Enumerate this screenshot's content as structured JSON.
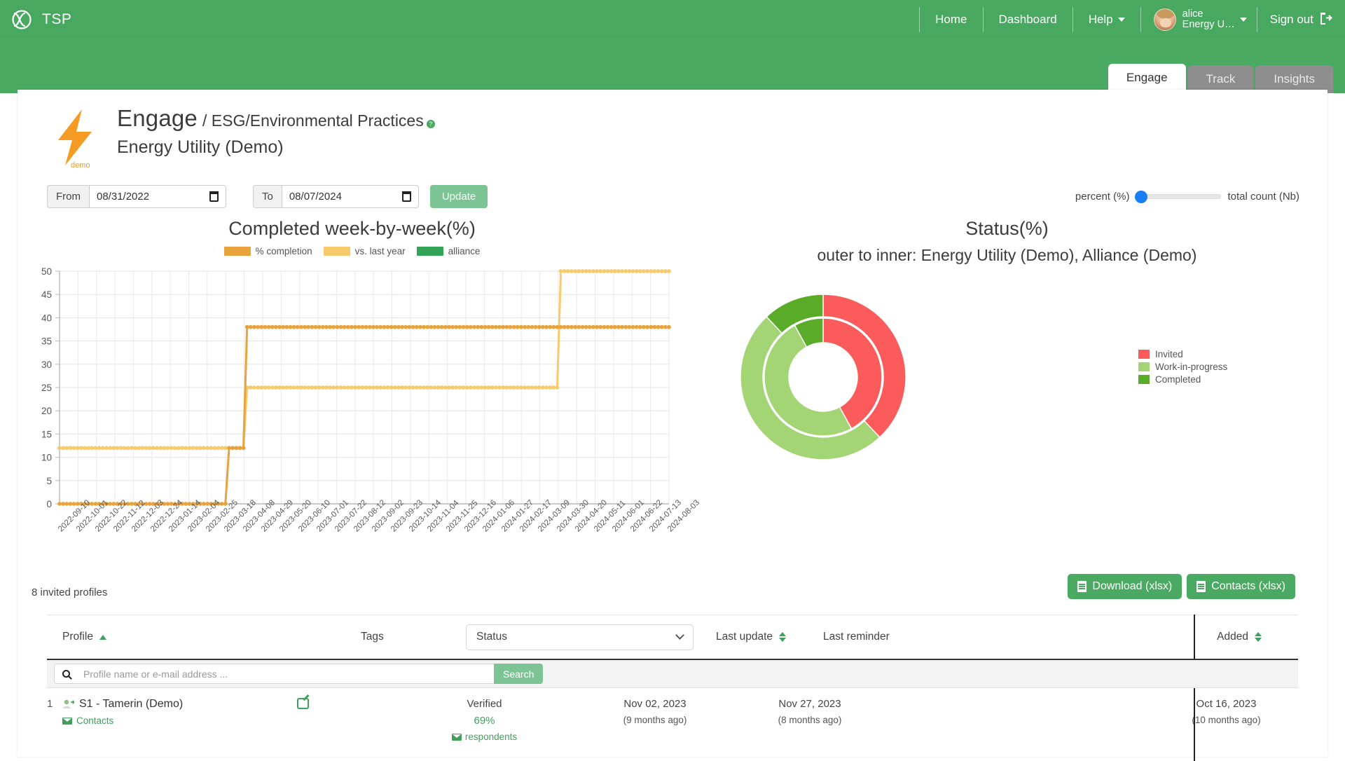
{
  "navbar": {
    "brand": "TSP",
    "links": [
      {
        "label": "Home",
        "icon": "none"
      },
      {
        "label": "Dashboard",
        "icon": "none"
      },
      {
        "label": "Help",
        "icon": "chevron-down-icon"
      }
    ],
    "user": {
      "name": "alice",
      "org": "Energy U…"
    },
    "signout": "Sign out"
  },
  "tabs": [
    {
      "label": "Engage",
      "active": true
    },
    {
      "label": "Track",
      "active": false
    },
    {
      "label": "Insights",
      "active": false
    }
  ],
  "header": {
    "app": "Engage",
    "path": "/ ESG/Environmental Practices",
    "subtitle": "Energy Utility (Demo)",
    "logo_caption": "demo",
    "help_badge": "?"
  },
  "filters": {
    "from_label": "From",
    "from_value": "08/31/2022",
    "to_label": "To",
    "to_value": "08/07/2024",
    "update_label": "Update",
    "slider_left": "percent (%)",
    "slider_right": "total count (Nb)",
    "slider_position": 0
  },
  "line_chart_legend": [
    {
      "label": "% completion",
      "color": "#e8a33d"
    },
    {
      "label": "vs. last year",
      "color": "#f7ca6b"
    },
    {
      "label": "alliance",
      "color": "#33a457"
    }
  ],
  "donut_legend": [
    {
      "label": "Invited",
      "color": "#fb5b5b"
    },
    {
      "label": "Work-in-progress",
      "color": "#a3d575"
    },
    {
      "label": "Completed",
      "color": "#5aab28"
    }
  ],
  "summary": {
    "invited_profiles": "8 invited profiles",
    "download_label": "Download (xlsx)",
    "contacts_label": "Contacts (xlsx)"
  },
  "table": {
    "headers": {
      "profile": "Profile",
      "tags": "Tags",
      "status": "Status",
      "last_update": "Last update",
      "last_reminder": "Last reminder",
      "added": "Added"
    },
    "search": {
      "placeholder": "Profile name or e-mail address ...",
      "value": "",
      "button": "Search"
    },
    "rows": [
      {
        "num": "1",
        "profile": "S1 - Tamerin (Demo)",
        "contacts": "Contacts",
        "status": "Verified",
        "percent": "69%",
        "respondents": "respondents",
        "last_update": "Nov 02, 2023",
        "last_update_rel": "(9 months ago)",
        "last_reminder": "Nov 27, 2023",
        "last_reminder_rel": "(8 months ago)",
        "added": "Oct 16, 2023",
        "added_rel": "(10 months ago)"
      }
    ]
  },
  "chart_data": [
    {
      "type": "line",
      "title": "Completed week-by-week(%)",
      "xlabel": "",
      "ylabel": "",
      "ylim": [
        0,
        50
      ],
      "yticks": [
        0,
        5,
        10,
        15,
        20,
        25,
        30,
        35,
        40,
        45,
        50
      ],
      "grid": true,
      "legend_position": "top",
      "x": [
        "2022-09-10",
        "2022-10-01",
        "2022-10-22",
        "2022-11-12",
        "2022-12-03",
        "2022-12-24",
        "2023-01-14",
        "2023-02-04",
        "2023-02-25",
        "2023-03-18",
        "2023-04-08",
        "2023-04-29",
        "2023-05-20",
        "2023-06-10",
        "2023-07-01",
        "2023-07-22",
        "2023-08-12",
        "2023-09-02",
        "2023-09-23",
        "2023-10-14",
        "2023-11-04",
        "2023-11-25",
        "2023-12-16",
        "2024-01-06",
        "2024-01-27",
        "2024-02-17",
        "2024-03-09",
        "2024-03-30",
        "2024-04-20",
        "2024-05-11",
        "2024-06-01",
        "2024-06-22",
        "2024-07-13",
        "2024-08-03"
      ],
      "series": [
        {
          "name": "% completion",
          "color": "#e8a33d",
          "comment": "0 until 2023-03-10, steps to 12 at 2023-03-11, steps to 38 at 2023-03-25, flat 38 thereafter",
          "values": [
            0,
            0,
            0,
            0,
            0,
            0,
            0,
            0,
            0,
            12,
            38,
            38,
            38,
            38,
            38,
            38,
            38,
            38,
            38,
            38,
            38,
            38,
            38,
            38,
            38,
            38,
            38,
            38,
            38,
            38,
            38,
            38,
            38,
            38
          ]
        },
        {
          "name": "vs. last year",
          "color": "#f7ca6b",
          "comment": "12 until 2023-03-18, steps to 25 at 2023-03-25, steps to 50 at 2024-03-23",
          "values": [
            12,
            12,
            12,
            12,
            12,
            12,
            12,
            12,
            12,
            12,
            25,
            25,
            25,
            25,
            25,
            25,
            25,
            25,
            25,
            25,
            25,
            25,
            25,
            25,
            25,
            25,
            25,
            50,
            50,
            50,
            50,
            50,
            50,
            50
          ]
        },
        {
          "name": "alliance",
          "color": "#33a457",
          "values": []
        }
      ]
    },
    {
      "type": "pie",
      "variant": "nested-donut",
      "title": "Status(%)",
      "subtitle": "outer to inner: Energy Utility (Demo), Alliance (Demo)",
      "rings": [
        {
          "name": "Energy Utility (Demo)",
          "position": "outer",
          "labels": [
            "Invited",
            "Work-in-progress",
            "Completed"
          ],
          "values": [
            38,
            50,
            12
          ],
          "colors": [
            "#fb5b5b",
            "#a3d575",
            "#5aab28"
          ]
        },
        {
          "name": "Alliance (Demo)",
          "position": "inner",
          "labels": [
            "Invited",
            "Work-in-progress",
            "Completed"
          ],
          "values": [
            42,
            50,
            8
          ],
          "colors": [
            "#fb5b5b",
            "#a3d575",
            "#5aab28"
          ]
        }
      ]
    }
  ]
}
